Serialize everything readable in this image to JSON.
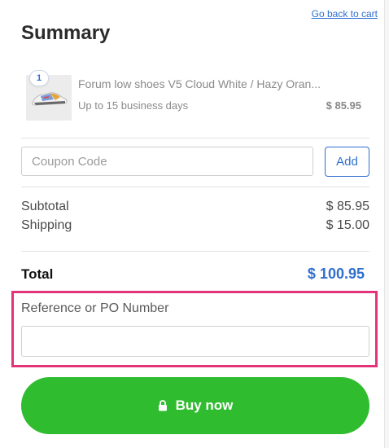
{
  "header": {
    "back_link": "Go back to cart",
    "title": "Summary"
  },
  "product": {
    "quantity": "1",
    "name": "Forum low shoes V5 Cloud White / Hazy Oran...",
    "delivery": "Up to 15 business days",
    "price": "$ 85.95",
    "image_icon": "sneaker-icon"
  },
  "coupon": {
    "placeholder": "Coupon Code",
    "add_label": "Add"
  },
  "totals": {
    "subtotal_label": "Subtotal",
    "subtotal_value": "$ 85.95",
    "shipping_label": "Shipping",
    "shipping_value": "$ 15.00",
    "total_label": "Total",
    "total_value": "$ 100.95"
  },
  "reference": {
    "label": "Reference or PO Number",
    "value": ""
  },
  "checkout": {
    "buy_label": "Buy now",
    "buy_icon": "lock-icon"
  },
  "colors": {
    "accent_blue": "#2f6fd0",
    "buy_green": "#2fbc2f",
    "highlight_pink": "#e3347a"
  }
}
